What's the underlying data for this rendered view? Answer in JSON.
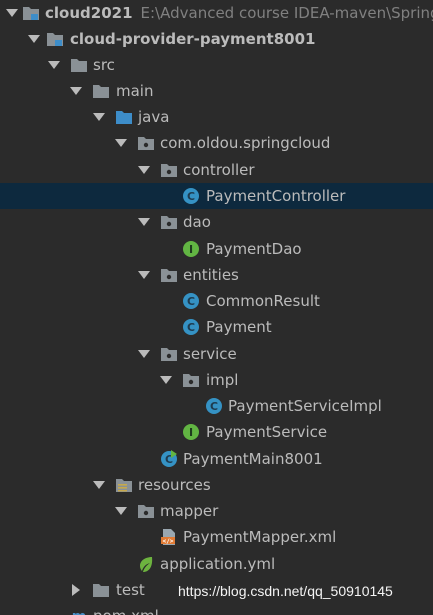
{
  "project": {
    "name": "cloud2021",
    "path": "E:\\Advanced course IDEA-maven\\SpringC"
  },
  "tree": [
    {
      "id": "cloud2021",
      "label": "cloud2021",
      "icon": "project-folder-icon",
      "expanded": true,
      "bold": true
    },
    {
      "id": "module",
      "label": "cloud-provider-payment8001",
      "icon": "module-folder-icon",
      "expanded": true,
      "bold": true
    },
    {
      "id": "src",
      "label": "src",
      "icon": "folder-icon",
      "expanded": true
    },
    {
      "id": "main",
      "label": "main",
      "icon": "folder-icon",
      "expanded": true
    },
    {
      "id": "java",
      "label": "java",
      "icon": "source-folder-icon",
      "expanded": true
    },
    {
      "id": "pkg",
      "label": "com.oldou.springcloud",
      "icon": "package-icon",
      "expanded": true
    },
    {
      "id": "controller",
      "label": "controller",
      "icon": "package-icon",
      "expanded": true
    },
    {
      "id": "PaymentController",
      "label": "PaymentController",
      "icon": "class-icon",
      "selected": true
    },
    {
      "id": "dao",
      "label": "dao",
      "icon": "package-icon",
      "expanded": true
    },
    {
      "id": "PaymentDao",
      "label": "PaymentDao",
      "icon": "interface-icon"
    },
    {
      "id": "entities",
      "label": "entities",
      "icon": "package-icon",
      "expanded": true
    },
    {
      "id": "CommonResult",
      "label": "CommonResult",
      "icon": "class-icon"
    },
    {
      "id": "Payment",
      "label": "Payment",
      "icon": "class-icon"
    },
    {
      "id": "service",
      "label": "service",
      "icon": "package-icon",
      "expanded": true
    },
    {
      "id": "impl",
      "label": "impl",
      "icon": "package-icon",
      "expanded": true
    },
    {
      "id": "PaymentServiceImpl",
      "label": "PaymentServiceImpl",
      "icon": "class-icon"
    },
    {
      "id": "PaymentService",
      "label": "PaymentService",
      "icon": "interface-icon"
    },
    {
      "id": "PaymentMain8001",
      "label": "PaymentMain8001",
      "icon": "spring-boot-class-icon"
    },
    {
      "id": "resources",
      "label": "resources",
      "icon": "resources-folder-icon",
      "expanded": true
    },
    {
      "id": "mapper",
      "label": "mapper",
      "icon": "package-icon",
      "expanded": true
    },
    {
      "id": "PaymentMapper",
      "label": "PaymentMapper.xml",
      "icon": "xml-file-icon"
    },
    {
      "id": "application",
      "label": "application.yml",
      "icon": "spring-yml-icon"
    },
    {
      "id": "test",
      "label": "test",
      "icon": "folder-icon",
      "expanded": false
    },
    {
      "id": "pom",
      "label": "pom.xml",
      "icon": "maven-icon"
    }
  ],
  "watermark": "https://blog.csdn.net/qq_50910145",
  "colors": {
    "background": "#2b2b2b",
    "selection": "#0d293e",
    "text": "#bbbbbb",
    "class_icon": "#3592c4",
    "interface_icon": "#62b543",
    "folder": "#8a9196",
    "source_folder": "#3d8dc9"
  }
}
